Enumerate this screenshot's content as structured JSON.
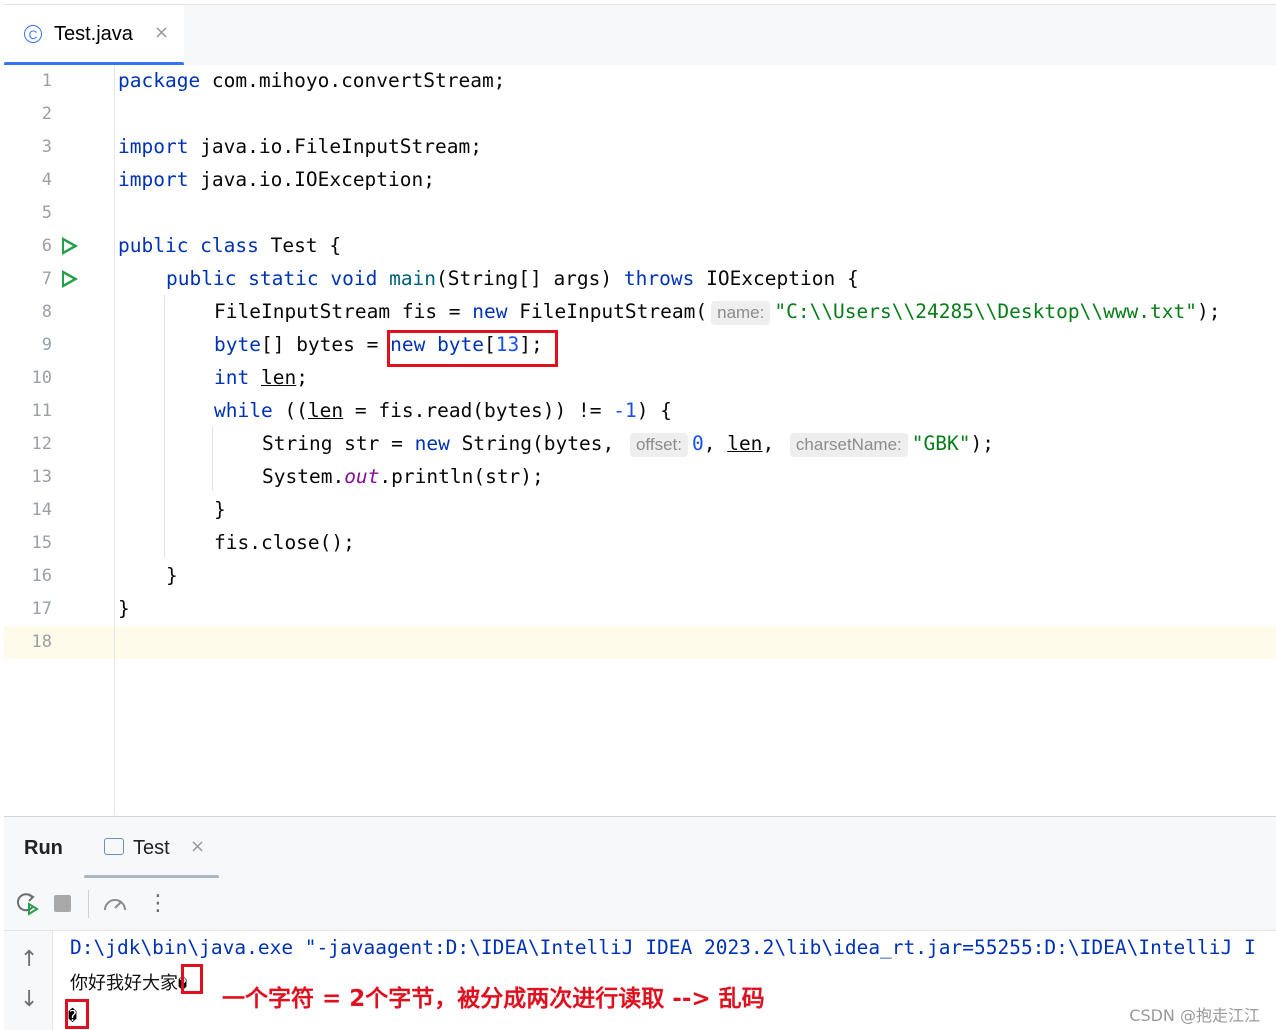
{
  "editor_tab": {
    "label": "Test.java",
    "icon": "class-c-icon",
    "close": "×"
  },
  "editor": {
    "line_numbers": [
      "1",
      "2",
      "3",
      "4",
      "5",
      "6",
      "7",
      "8",
      "9",
      "10",
      "11",
      "12",
      "13",
      "14",
      "15",
      "16",
      "17",
      "18"
    ],
    "code": {
      "l1_kw": "package",
      "l1_rest": " com.mihoyo.convertStream;",
      "l3_kw": "import",
      "l3_rest": " java.io.FileInputStream;",
      "l4_kw": "import",
      "l4_rest": " java.io.IOException;",
      "l6_kw": "public class",
      "l6_rest": " Test {",
      "l7_kw": "public static void",
      "l7_fn": "main",
      "l7_a": "(String[] args) ",
      "l7_kw2": "throws",
      "l7_b": " IOException {",
      "l8_a": "FileInputStream fis = ",
      "l8_kw": "new",
      "l8_b": " FileInputStream(",
      "l8_hint": "name:",
      "l8_str": "\"C:\\\\Users\\\\24285\\\\Desktop\\\\www.txt\"",
      "l8_c": ");",
      "l9_kw": "byte",
      "l9_a": "[] bytes = ",
      "l9_kw2": "new byte",
      "l9_b": "[",
      "l9_num": "13",
      "l9_c": "];",
      "l10_kw": "int",
      "l10_var": "len",
      "l10_c": ";",
      "l11_kw": "while",
      "l11_a": " ((",
      "l11_var": "len",
      "l11_b": " = fis.read(bytes)) != ",
      "l11_num": "-1",
      "l11_c": ") {",
      "l12_a": "String str = ",
      "l12_kw": "new",
      "l12_b": " String(bytes, ",
      "l12_hint1": "offset:",
      "l12_num": "0",
      "l12_c": ", ",
      "l12_var": "len",
      "l12_d": ", ",
      "l12_hint2": "charsetName:",
      "l12_str": "\"GBK\"",
      "l12_e": ");",
      "l13_a": "System.",
      "l13_out": "out",
      "l13_b": ".println(str);",
      "l14": "}",
      "l15": "fis.close();",
      "l16": "}",
      "l17": "}"
    }
  },
  "run_panel": {
    "title": "Run",
    "tab_label": "Test",
    "tab_close": "×",
    "toolbar": {
      "rerun_icon": "rerun-icon",
      "stop_icon": "stop-icon",
      "profiler_icon": "speedometer-icon",
      "more": "⋮"
    },
    "side": {
      "up": "↑",
      "down": "↓"
    },
    "console": {
      "command": "D:\\jdk\\bin\\java.exe \"-javaagent:D:\\IDEA\\IntelliJ IDEA 2023.2\\lib\\idea_rt.jar=55255:D:\\IDEA\\IntelliJ I",
      "output1": "你好我好大家",
      "garbled1": "�",
      "garbled2": "�"
    }
  },
  "annotation": "一个字符 = 2个字节，被分成两次进行读取 --> 乱码",
  "watermark": "CSDN @抱走江江",
  "colors": {
    "keyword": "#0033b3",
    "string": "#067d17",
    "number": "#1750eb",
    "highlight_box": "#e0101f",
    "run_gutter": "#24a148",
    "tab_accent": "#3574f0"
  }
}
